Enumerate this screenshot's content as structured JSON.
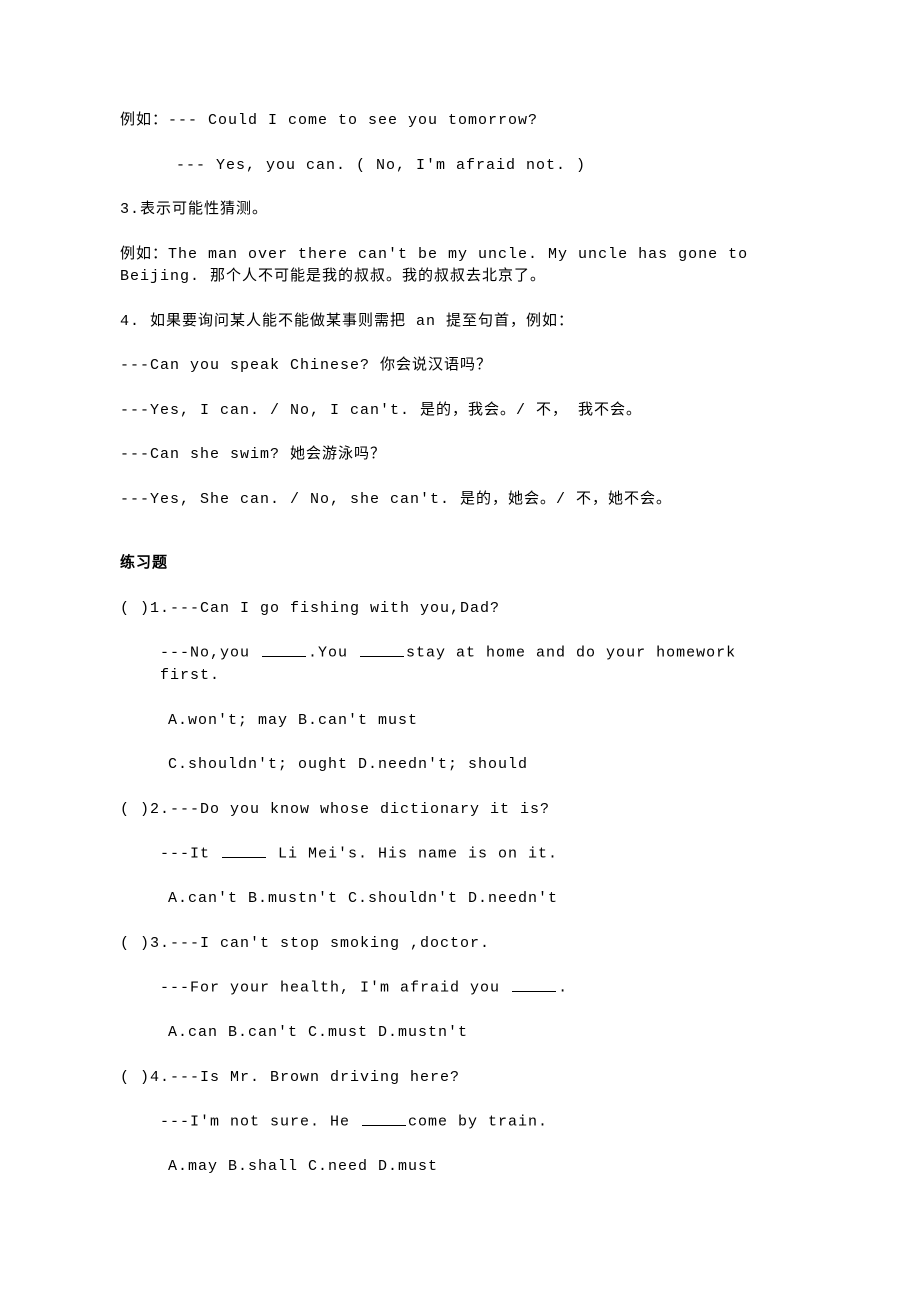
{
  "lines": {
    "l1": "例如：--- Could I come to see you tomorrow?",
    "l2": "--- Yes, you can. ( No, I'm afraid not. )",
    "l3": "3.表示可能性猜测。",
    "l4": "例如：The man over there can't be my uncle. My uncle has gone to Beijing. 那个人不可能是我的叔叔。我的叔叔去北京了。",
    "l5": "4.  如果要询问某人能不能做某事则需把 an 提至句首，例如：",
    "l6": "---Can you speak Chinese?   你会说汉语吗？",
    "l7": "---Yes, I can. / No, I can't.   是的，我会。/ 不， 我不会。",
    "l8": "---Can she swim?   她会游泳吗？",
    "l9": "---Yes, She can. / No, she can't.    是的，她会。/ 不，她不会。",
    "exTitle": "练习题",
    "q1a": "(  )1.---Can I go fishing with you,Dad?",
    "q1b_pre": "---No,you ",
    "q1b_mid": ".You ",
    "q1b_post": "stay at home and do your homework first.",
    "q1c": "A.won't; may   B.can't must",
    "q1d": "C.shouldn't; ought   D.needn't; should",
    "q2a": "(  )2.---Do you know whose dictionary it is?",
    "q2b_pre": "---It ",
    "q2b_post": " Li Mei's. His name is on it.",
    "q2c": "A.can't   B.mustn't   C.shouldn't   D.needn't",
    "q3a": "(  )3.---I can't stop smoking ,doctor.",
    "q3b_pre": "---For your health, I'm afraid you ",
    "q3b_post": ".",
    "q3c": "A.can   B.can't   C.must   D.mustn't",
    "q4a": "(  )4.---Is Mr. Brown driving here?",
    "q4b_pre": "---I'm not sure. He ",
    "q4b_post": "come by train.",
    "q4c": "A.may    B.shall   C.need   D.must"
  }
}
